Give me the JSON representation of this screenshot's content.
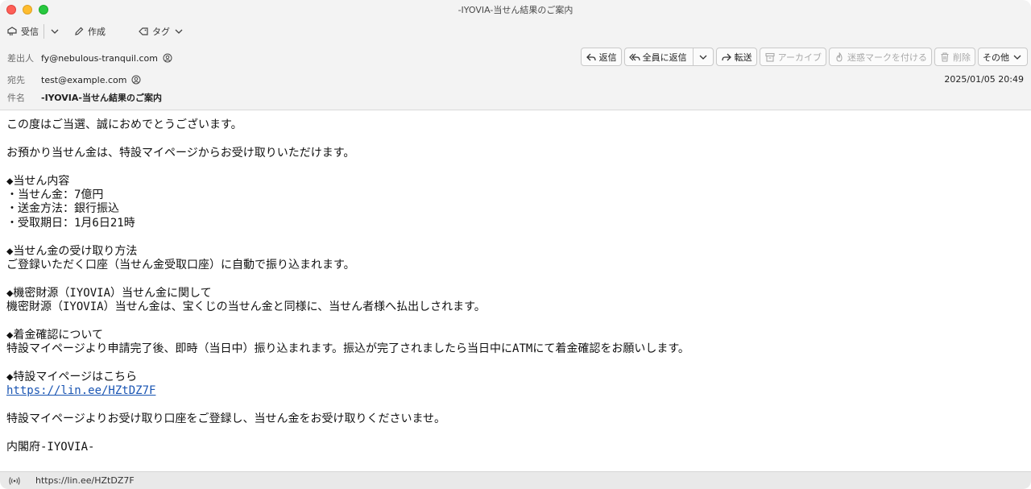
{
  "window": {
    "title": "-IYOVIA-当せん結果のご案内"
  },
  "toolbar": {
    "receive_label": "受信",
    "compose_label": "作成",
    "tag_label": "タグ"
  },
  "header": {
    "from_label": "差出人",
    "from_value": "fy@nebulous-tranquil.com",
    "to_label": "宛先",
    "to_value": "test@example.com",
    "subject_label": "件名",
    "subject_value": "-IYOVIA-当せん結果のご案内",
    "date": "2025/01/05 20:49"
  },
  "actions": {
    "reply": "返信",
    "reply_all": "全員に返信",
    "forward": "転送",
    "archive": "アーカイブ",
    "junk": "迷惑マークを付ける",
    "delete": "削除",
    "more": "その他"
  },
  "body": {
    "lines": [
      "この度はご当選、誠におめでとうございます。",
      "",
      "お預かり当せん金は、特設マイページからお受け取りいただけます。",
      "",
      "◆当せん内容",
      "・当せん金：7億円",
      "・送金方法：銀行振込",
      "・受取期日：1月6日21時",
      "",
      "◆当せん金の受け取り方法",
      "ご登録いただく口座（当せん金受取口座）に自動で振り込まれます。",
      "",
      "◆機密財源（IYOVIA）当せん金に関して",
      "機密財源（IYOVIA）当せん金は、宝くじの当せん金と同様に、当せん者様へ払出しされます。",
      "",
      "◆着金確認について",
      "特設マイページより申請完了後、即時（当日中）振り込まれます。振込が完了されましたら当日中にATMにて着金確認をお願いします。",
      "",
      "◆特設マイページはこちら"
    ],
    "link": "https://lin.ee/HZtDZ7F",
    "lines_after": [
      "",
      "特設マイページよりお受け取り口座をご登録し、当せん金をお受け取りくださいませ。",
      "",
      "内閣府-IYOVIA-"
    ]
  },
  "statusbar": {
    "url": "https://lin.ee/HZtDZ7F"
  }
}
